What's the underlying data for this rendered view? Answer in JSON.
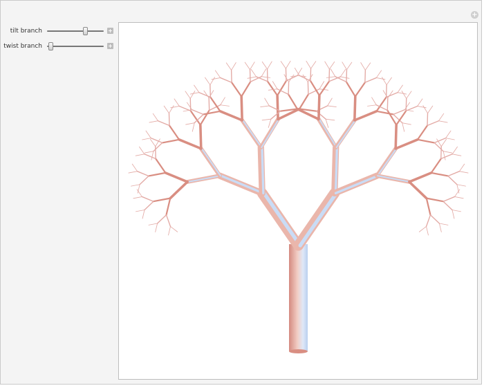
{
  "controls": [
    {
      "label": "tilt branch",
      "value": 0.68,
      "plus": "+"
    },
    {
      "label": "twist branch",
      "value": 0.07,
      "plus": "+"
    }
  ],
  "corner_button": "+",
  "tree": {
    "depth": 7,
    "fork_angle_degrees": 33,
    "length_ratio": 0.72,
    "width_ratio": 0.62,
    "colors": {
      "bark_main": "#eab6ab",
      "bark_highlight": "#c9dcf6",
      "bark_dark": "#d98e82",
      "twig": "#e3aaa5"
    }
  }
}
